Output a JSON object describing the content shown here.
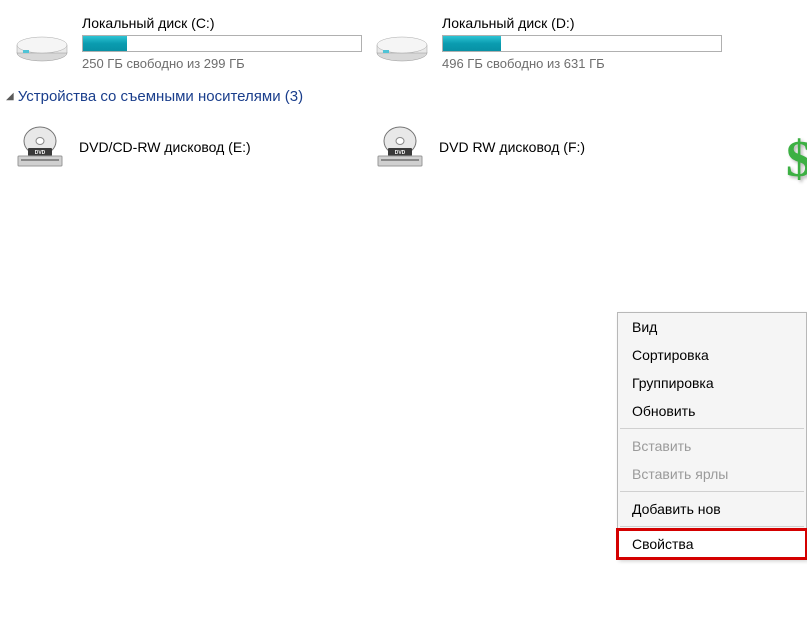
{
  "drives": [
    {
      "name": "Локальный диск (C:)",
      "status": "250 ГБ свободно из 299 ГБ",
      "fill_percent": 16
    },
    {
      "name": "Локальный диск (D:)",
      "status": "496 ГБ свободно из 631 ГБ",
      "fill_percent": 21
    }
  ],
  "section_header": "Устройства со съемными носителями (3)",
  "optical": [
    {
      "name": "DVD/CD-RW дисковод (E:)"
    },
    {
      "name": "DVD RW дисковод (F:)"
    }
  ],
  "context_menu": {
    "view": "Вид",
    "sort": "Сортировка",
    "group": "Группировка",
    "refresh": "Обновить",
    "paste": "Вставить",
    "paste_shortcut": "Вставить ярлы",
    "add_new": "Добавить нов",
    "properties": "Свойства"
  }
}
